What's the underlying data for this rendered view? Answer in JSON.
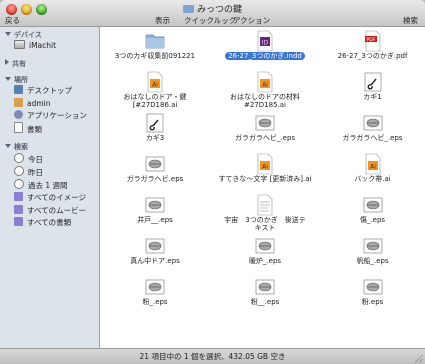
{
  "window": {
    "title": "みっつの鍵"
  },
  "toolbar": {
    "back": "戻る",
    "view": "表示",
    "quicklook": "クイックルック",
    "action": "アクション",
    "search": "検索"
  },
  "sidebar": {
    "devices_label": "デバイス",
    "devices": [
      {
        "label": "iMachit",
        "icon": "hard-drive-icon"
      }
    ],
    "shared_label": "共有",
    "places_label": "場所",
    "places": [
      {
        "label": "デスクトップ",
        "icon": "desktop-icon"
      },
      {
        "label": "admin",
        "icon": "home-icon"
      },
      {
        "label": "アプリケーション",
        "icon": "applications-icon"
      },
      {
        "label": "書類",
        "icon": "documents-icon"
      }
    ],
    "search_label": "検索",
    "searches": [
      {
        "label": "今日",
        "icon": "clock-icon"
      },
      {
        "label": "昨日",
        "icon": "clock-icon"
      },
      {
        "label": "過去 1 週間",
        "icon": "clock-icon"
      },
      {
        "label": "すべてのイメージ",
        "icon": "smart-folder-icon"
      },
      {
        "label": "すべてのムービー",
        "icon": "smart-folder-icon"
      },
      {
        "label": "すべての書類",
        "icon": "smart-folder-icon"
      }
    ]
  },
  "files": [
    {
      "name": "3つのカギ収集前091221",
      "kind": "folder",
      "icon": "folder-icon",
      "selected": false
    },
    {
      "name": "26-27_3つのかぎ.indd",
      "kind": "indd",
      "icon": "indesign-file-icon",
      "selected": true
    },
    {
      "name": "26-27_3つのかぎ.pdf",
      "kind": "pdf",
      "icon": "pdf-file-icon",
      "selected": false
    },
    {
      "name": "おはなしのドア・鍵\n[#27D186.ai",
      "kind": "ai",
      "icon": "illustrator-file-icon",
      "selected": false
    },
    {
      "name": "おはなしのドアの材料\n#27D185.ai",
      "kind": "ai",
      "icon": "illustrator-file-icon",
      "selected": false
    },
    {
      "name": "カギ1",
      "kind": "img",
      "icon": "image-file-icon",
      "selected": false
    },
    {
      "name": "カギ3",
      "kind": "img",
      "icon": "image-file-icon",
      "selected": false
    },
    {
      "name": "ガラガラヘビ_.eps",
      "kind": "eps",
      "icon": "eps-file-icon",
      "selected": false
    },
    {
      "name": "ガラガラヘビ_.eps",
      "kind": "eps",
      "icon": "eps-file-icon",
      "selected": false
    },
    {
      "name": "ガラガラヘビ.eps",
      "kind": "eps",
      "icon": "eps-file-icon",
      "selected": false
    },
    {
      "name": "すてきな〜文字 [更新済み].ai",
      "kind": "ai",
      "icon": "illustrator-file-icon",
      "selected": false
    },
    {
      "name": "バック帯.ai",
      "kind": "ai",
      "icon": "illustrator-file-icon",
      "selected": false
    },
    {
      "name": "井戸__.eps",
      "kind": "eps",
      "icon": "eps-file-icon",
      "selected": false
    },
    {
      "name": "宇宙　3つのかぎ　後送テ\nキスト",
      "kind": "doc",
      "icon": "document-file-icon",
      "selected": false
    },
    {
      "name": "傷_.eps",
      "kind": "eps",
      "icon": "eps-file-icon",
      "selected": false
    },
    {
      "name": "真ん中ドア.eps",
      "kind": "eps",
      "icon": "eps-file-icon",
      "selected": false
    },
    {
      "name": "暖炉_.eps",
      "kind": "eps",
      "icon": "eps-file-icon",
      "selected": false
    },
    {
      "name": "帆船_.eps",
      "kind": "eps",
      "icon": "eps-file-icon",
      "selected": false
    },
    {
      "name": "粉_.eps",
      "kind": "eps",
      "icon": "eps-file-icon",
      "selected": false
    },
    {
      "name": "粉__.eps",
      "kind": "eps",
      "icon": "eps-file-icon",
      "selected": false
    },
    {
      "name": "粉.eps",
      "kind": "eps",
      "icon": "eps-file-icon",
      "selected": false
    }
  ],
  "status": {
    "text": "21 項目中の 1 個を選択、432.05 GB 空き"
  },
  "colors": {
    "selection": "#3875d7",
    "sidebar": "#dde3ea",
    "ai_orange": "#f7941d",
    "indd_purple": "#5c2b7a",
    "pdf_red": "#c8231b"
  }
}
